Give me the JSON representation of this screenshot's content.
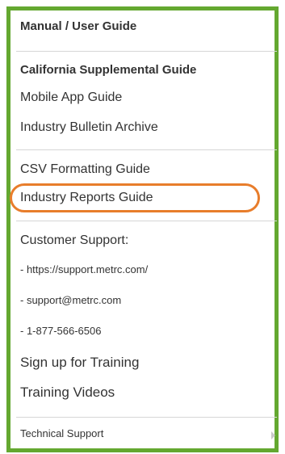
{
  "menu": {
    "header": "Manual / User Guide",
    "items": [
      "California Supplemental Guide",
      "Mobile App Guide",
      "Industry Bulletin Archive",
      "CSV Formatting Guide",
      "Industry Reports Guide",
      "Customer Support:",
      "- https://support.metrc.com/",
      "- support@metrc.com",
      "- 1-877-566-6506",
      "Sign up for Training",
      "Training Videos",
      "Technical Support"
    ]
  },
  "colors": {
    "frame_border": "#64a830",
    "highlight_ring": "#e87d2b",
    "text": "#333333"
  }
}
